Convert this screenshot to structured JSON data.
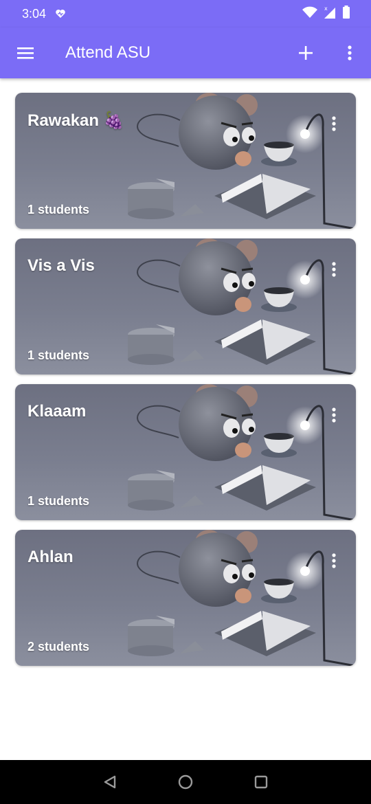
{
  "status_bar": {
    "time": "3:04"
  },
  "app_bar": {
    "title": "Attend ASU"
  },
  "colors": {
    "accent": "#7b6cf6",
    "card_bg": "#7a7e8f",
    "nav_bar": "#000000"
  },
  "classes": [
    {
      "name": "Rawakan 🍇",
      "students": "1 students"
    },
    {
      "name": "Vis a Vis",
      "students": "1 students"
    },
    {
      "name": "Klaaam",
      "students": "1 students"
    },
    {
      "name": "Ahlan",
      "students": "2 students"
    }
  ],
  "icons": {
    "menu": "hamburger-menu-icon",
    "add": "plus-icon",
    "more": "vertical-dots-icon",
    "back": "back-triangle-icon",
    "home": "home-circle-icon",
    "recents": "recents-square-icon"
  }
}
